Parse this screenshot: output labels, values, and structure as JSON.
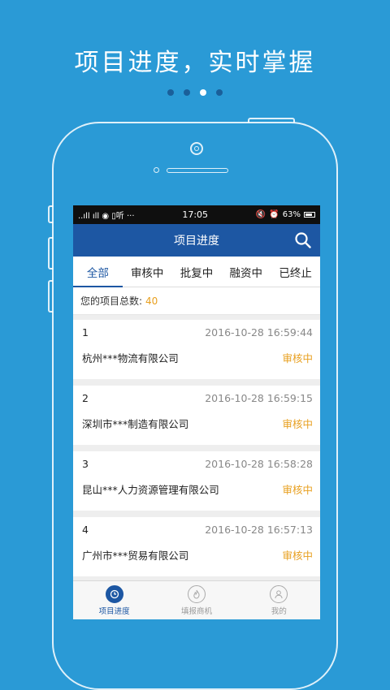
{
  "headline": "项目进度，实时掌握",
  "status_bar": {
    "left": "..ıll ıll ◉ ▯听 ···",
    "time": "17:05",
    "battery": "63%"
  },
  "appbar": {
    "title": "项目进度"
  },
  "tabs": [
    {
      "label": "全部",
      "active": true
    },
    {
      "label": "审核中",
      "active": false
    },
    {
      "label": "批复中",
      "active": false
    },
    {
      "label": "融资中",
      "active": false
    },
    {
      "label": "已终止",
      "active": false
    }
  ],
  "summary": {
    "label": "您的项目总数:",
    "count": "40"
  },
  "projects": [
    {
      "index": "1",
      "time": "2016-10-28 16:59:44",
      "company": "杭州***物流有限公司",
      "status": "审核中"
    },
    {
      "index": "2",
      "time": "2016-10-28 16:59:15",
      "company": "深圳市***制造有限公司",
      "status": "审核中"
    },
    {
      "index": "3",
      "time": "2016-10-28 16:58:28",
      "company": "昆山***人力资源管理有限公司",
      "status": "审核中"
    },
    {
      "index": "4",
      "time": "2016-10-28 16:57:13",
      "company": "广州市***贸易有限公司",
      "status": "审核中"
    }
  ],
  "bottom_nav": [
    {
      "label": "项目进度",
      "icon": "clock-icon",
      "active": true
    },
    {
      "label": "填报商机",
      "icon": "flame-icon",
      "active": false
    },
    {
      "label": "我的",
      "icon": "user-icon",
      "active": false
    }
  ],
  "colors": {
    "background": "#2a9ad6",
    "primary": "#1d57a3",
    "accent": "#e8a020"
  }
}
